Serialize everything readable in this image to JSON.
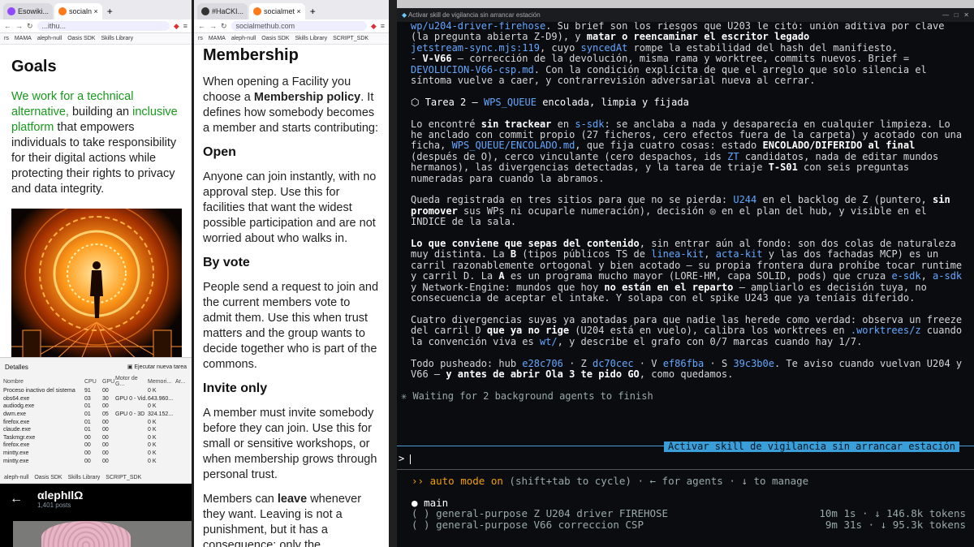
{
  "left_browser": {
    "tabs": [
      {
        "label": "Esowiki...",
        "icon": "twitch-icon"
      },
      {
        "label": "socialn ×",
        "icon": "firefox-icon"
      }
    ],
    "url": "...ithu...",
    "bookmarks": [
      "rs",
      "MAMA",
      "aleph-null",
      "Oasis SDK",
      "Skills Library"
    ],
    "heading": "Goals",
    "para_green1": "We work for a technical alternative,",
    "para_mid1": "building an ",
    "para_green2": "inclusive platform",
    "para_rest": " that empowers individuals to take responsibility for their digital actions while protecting their rights to privacy and data integrity."
  },
  "middle_browser": {
    "tabs": [
      {
        "label": "#HaCKI...",
        "icon": "hack-icon"
      },
      {
        "label": "socialmet ×",
        "icon": "firefox-icon"
      }
    ],
    "url": "socialmethub.com",
    "bookmarks": [
      "rs",
      "MAMA",
      "aleph-null",
      "Oasis SDK",
      "Skills Library",
      "SCRIPT_SDK"
    ],
    "title": "Membership",
    "intro_a": "When opening a Facility you choose a ",
    "intro_b": "Membership policy",
    "intro_c": ". It defines how somebody becomes a member and starts contributing:",
    "open_h": "Open",
    "open_p": "Anyone can join instantly, with no approval step. Use this for facilities that want the widest possible participation and are not worried about who walks in.",
    "vote_h": "By vote",
    "vote_p": "People send a request to join and the current members vote to admit them. Use this when trust matters and the group wants to decide together who is part of the commons.",
    "invite_h": "Invite only",
    "invite_p": "A member must invite somebody before they can join. Use this for small or sensitive workshops, or when membership grows through personal trust.",
    "leave_a": "Members can ",
    "leave_b": "leave",
    "leave_c": " whenever they want. Leaving is not a punishment, but it has a consequence: only the"
  },
  "task_manager": {
    "title": "Detalles",
    "run_task": "Ejecutar nueva tarea",
    "columns": [
      "Nombre",
      "CPU",
      "GPU",
      "Motor de G...",
      "Memori...",
      "Ar..."
    ],
    "rows": [
      [
        "Proceso inactivo del sistema",
        "91",
        "00",
        "",
        "0 K",
        ""
      ],
      [
        "obs64.exe",
        "03",
        "30",
        "GPU 0 - Vid...",
        "643.960...",
        ""
      ],
      [
        "audiodg.exe",
        "01",
        "00",
        "",
        "0 K",
        ""
      ],
      [
        "dwm.exe",
        "01",
        "05",
        "GPU 0 - 3D",
        "324.152...",
        ""
      ],
      [
        "firefox.exe",
        "01",
        "00",
        "",
        "0 K",
        ""
      ],
      [
        "claude.exe",
        "01",
        "00",
        "",
        "0 K",
        ""
      ],
      [
        "Taskmgr.exe",
        "00",
        "00",
        "",
        "0 K",
        ""
      ],
      [
        "firefox.exe",
        "00",
        "00",
        "",
        "0 K",
        ""
      ],
      [
        "mintty.exe",
        "00",
        "00",
        "",
        "0 K",
        ""
      ],
      [
        "mintty.exe",
        "00",
        "00",
        "",
        "0 K",
        ""
      ]
    ]
  },
  "bottom_window": {
    "bookmarks": [
      "aleph-null",
      "Oasis SDK",
      "Skills Library",
      "SCRIPT_SDK"
    ],
    "profile_name": "αlephIlΩ",
    "posts": "1,401 posts"
  },
  "terminal": {
    "window_title": "Activar skill de vigilancia sin arrancar estación",
    "lines": {
      "l1a": "wp/u204-driver-firehose",
      "l1b": ". Su brief son los riesgos que U203 le citó: unión aditiva por clave (la pregunta abierta Z-D9), y ",
      "l1c": "matar o reencaminar el escritor legado",
      "l1d": "jetstream-sync.mjs:119",
      "l1e": ", cuyo ",
      "l1f": "syncedAt",
      "l1g": " rompe la estabilidad del hash del manifiesto.",
      "l2a": "- ",
      "l2b": "V-V66",
      "l2c": " — corrección de la devolución, misma rama y worktree, commits nuevos. Brief = ",
      "l2d": "DEVOLUCION-V66-csp.md",
      "l2e": ". Con la condición explícita de que el arreglo que solo silencia el síntoma vuelve a caer, y contrarrevisión adversarial nueva al cerrar.",
      "t2a": "Tarea 2 — ",
      "t2b": "WPS_QUEUE",
      "t2c": " encolada, limpia y fijada",
      "p1a": "Lo encontré ",
      "p1b": "sin trackear",
      "p1c": " en ",
      "p1d": "s-sdk",
      "p1e": ": se anclaba a nada y desaparecía en cualquier limpieza. Lo he anclado con commit propio (27 ficheros, cero efectos fuera de la carpeta) y acotado con una ficha, ",
      "p1f": "WPS_QUEUE/ENCOLADO.md",
      "p1g": ", que fija cuatro cosas: estado ",
      "p1h": "ENCOLADO/DIFERIDO al final",
      "p1i": " (después de O), cerco vinculante (cero despachos, ids ",
      "p1j": "ZT",
      "p1k": " candidatos, nada de editar mundos hermanos), las divergencias detectadas, y la tarea de triaje ",
      "p1l": "T-S01",
      "p1m": " con seis preguntas numeradas para cuando la abramos.",
      "p2a": "Queda registrada en tres sitios para que no se pierda: ",
      "p2b": "U244",
      "p2c": " en el backlog de Z (puntero, ",
      "p2d": "sin promover",
      "p2e": " sus WPs ni ocuparle numeración), decisión ◎ en el plan del hub, y visible en el INDICE de la sala.",
      "p3a": "Lo que conviene que sepas del contenido",
      "p3b": ", sin entrar aún al fondo: son dos colas de naturaleza muy distinta. La ",
      "p3c": "B",
      "p3d": " (tipos públicos TS de ",
      "p3e": "linea-kit",
      "p3f": ", ",
      "p3g": "acta-kit",
      "p3h": " y las dos fachadas MCP) es un carril razonablemente ortogonal y bien acotado — su propia frontera dura prohíbe tocar runtime y carril D. La ",
      "p3i": "A",
      "p3j": " es un programa mucho mayor (LORE-HM, capa SOLID, pods) que cruza ",
      "p3k": "e-sdk",
      "p3l": ", ",
      "p3m": "a-sdk",
      "p3n": " y Network-Engine: mundos que hoy ",
      "p3o": "no están en el reparto",
      "p3p": " — ampliarlo es decisión tuya, no consecuencia de aceptar el intake. Y solapa con el spike U243 que ya teníais diferido.",
      "p4a": "Cuatro divergencias suyas ya anotadas para que nadie las herede como verdad: observa un freeze del carril D ",
      "p4b": "que ya no rige",
      "p4c": " (U204 está en vuelo), calibra los worktrees en ",
      "p4d": ".worktrees/z",
      "p4e": " cuando la convención viva es ",
      "p4f": "wt/",
      "p4g": ", y describe el grafo con 0/7 marcas cuando hay 1/7.",
      "p5a": "Todo pusheado: hub ",
      "p5b": "e28c706",
      "p5c": " · Z ",
      "p5d": "dc70cec",
      "p5e": " · V ",
      "p5f": "ef86fba",
      "p5g": " · S ",
      "p5h": "39c3b0e",
      "p5i": ". Te aviso cuando vuelvan U204 y V66 — ",
      "p5j": "y antes de abrir Ola 3 te pido GO",
      "p5k": ", como quedamos.",
      "waiting": "Waiting for 2 background agents to finish",
      "banner": "Activar skill de vigilancia sin arrancar estación",
      "prompt": ">",
      "auto_a": "auto mode on",
      "auto_b": " (shift+tab to cycle) · ← for agents · ↓ to manage",
      "main": "main"
    },
    "agents": [
      {
        "label": "( ) general-purpose  Z U204 driver FIREHOSE",
        "stats": "10m 1s · ↓ 146.8k tokens"
      },
      {
        "label": "( ) general-purpose  V66 correccion CSP",
        "stats": "9m 31s · ↓ 95.3k tokens"
      }
    ]
  }
}
